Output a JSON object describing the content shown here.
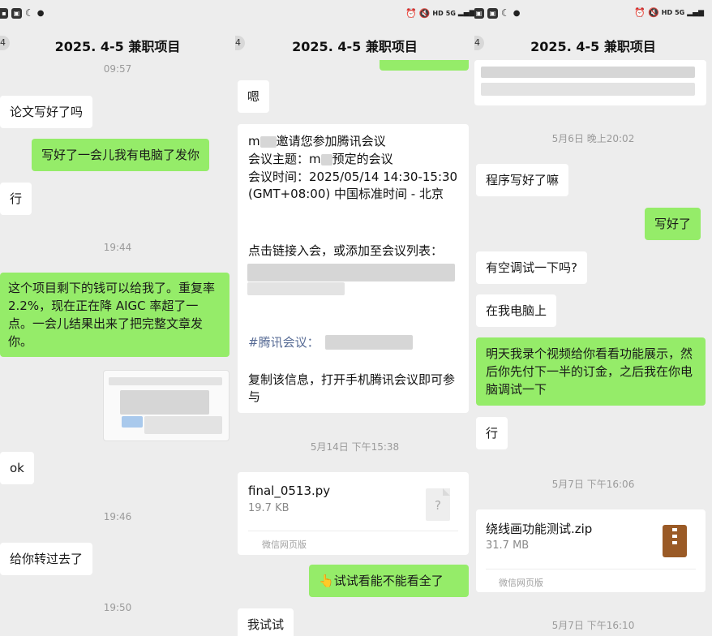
{
  "status_bar": {
    "hd": "HD",
    "net": "5G"
  },
  "panels": [
    {
      "title": "2025. 4-5 兼职项目",
      "unread": "4"
    },
    {
      "title": "2025. 4-5 兼职项目",
      "unread": "4"
    },
    {
      "title": "2025. 4-5 兼职项目",
      "unread": "4"
    }
  ],
  "chat1": {
    "t1": "09:57",
    "m1": "论文写好了吗",
    "m2": "写好了一会儿我有电脑了发你",
    "m3": "行",
    "t2": "19:44",
    "m4": "这个项目剩下的钱可以给我了。重复率 2.2%，现在正在降 AIGC 率超了一点。一会儿结果出来了把完整文章发你。",
    "m5": "ok",
    "t3": "19:46",
    "m6": "给你转过去了",
    "t4": "19:50"
  },
  "chat2": {
    "m1": "嗯",
    "meeting": {
      "line1_a": "m",
      "line1_b": "邀请您参加腾讯会议",
      "topic_a": "会议主题：m",
      "topic_b": "预定的会议",
      "time": "会议时间：2025/05/14 14:30-15:30 (GMT+08:00) 中国标准时间 - 北京",
      "join": "点击链接入会，或添加至会议列表：",
      "tag": "#腾讯会议：",
      "copy": "复制该信息，打开手机腾讯会议即可参与"
    },
    "t1": "5月14日 下午15:38",
    "file": {
      "name": "final_0513.py",
      "size": "19.7 KB",
      "source": "微信网页版",
      "glyph": "?"
    },
    "m2_emoji": "👆",
    "m2": "试试看能不能看全了",
    "m3": "我试试"
  },
  "chat3": {
    "t1": "5月6日 晚上20:02",
    "m1": "程序写好了嘛",
    "m2": "写好了",
    "m3": "有空调试一下吗?",
    "m4": "在我电脑上",
    "m5": "明天我录个视频给你看看功能展示，然后你先付下一半的订金，之后我在你电脑调试一下",
    "m6": "行",
    "t2": "5月7日 下午16:06",
    "file": {
      "name": "绕线画功能测试.zip",
      "size": "31.7 MB",
      "source": "微信网页版"
    },
    "t3": "5月7日 下午16:10"
  }
}
